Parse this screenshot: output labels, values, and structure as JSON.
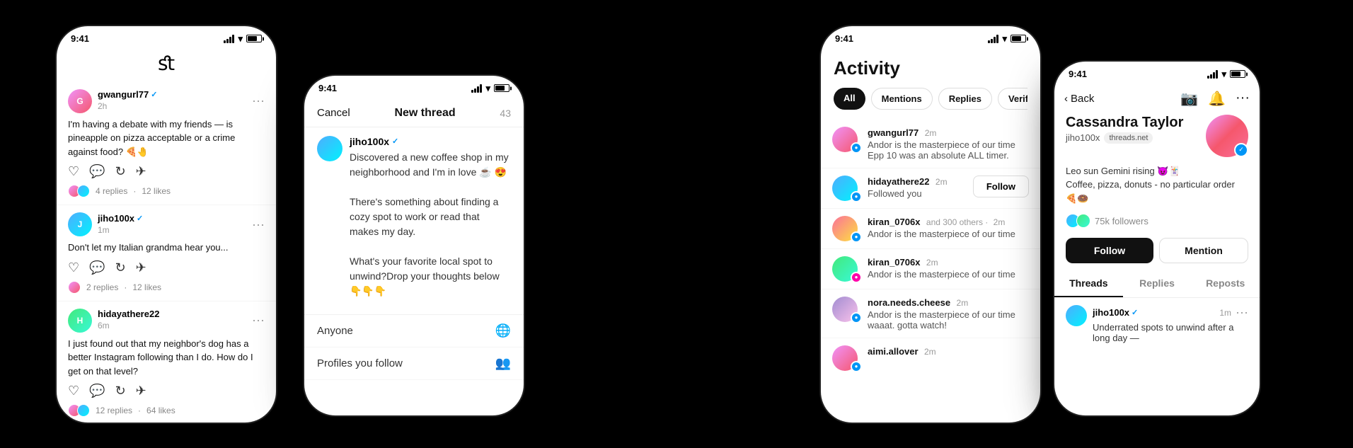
{
  "phone1": {
    "status": {
      "time": "9:41",
      "signal": true,
      "wifi": true,
      "battery": true
    },
    "posts": [
      {
        "username": "gwangurl77",
        "verified": true,
        "time": "2h",
        "content": "I'm having a debate with my friends — is pineapple on pizza acceptable or a crime against food? 🍕🤚",
        "replies": "4 replies",
        "likes": "12 likes",
        "avatar_style": "pink"
      },
      {
        "username": "jiho100x",
        "verified": true,
        "time": "1m",
        "content": "Don't let my Italian grandma hear you...",
        "replies": "2 replies",
        "likes": "12 likes",
        "avatar_style": "blue"
      },
      {
        "username": "hidayathere22",
        "verified": false,
        "time": "6m",
        "content": "I just found out that my neighbor's dog has a better Instagram following than I do. How do I get on that level?",
        "replies": "12 replies",
        "likes": "64 likes",
        "avatar_style": "green"
      }
    ]
  },
  "phone2": {
    "status": {
      "time": "9:41"
    },
    "header": {
      "cancel": "Cancel",
      "title": "New thread",
      "char_count": "43"
    },
    "compose": {
      "username": "jiho100x",
      "verified": true,
      "text": "Discovered a new coffee shop in my neighborhood and I'm in love ☕ 😍\n\nThere's something about finding a cozy spot to work or read that makes my day.\n\nWhat's your favorite local spot to unwind?Drop your thoughts below 👇👇👇"
    },
    "audience": {
      "options": [
        {
          "label": "Anyone",
          "icon": "🌐"
        },
        {
          "label": "Profiles you follow",
          "icon": "👥"
        }
      ]
    }
  },
  "phone3": {
    "status": {
      "time": "9:41"
    },
    "header": {
      "title": "Activity"
    },
    "filters": [
      "All",
      "Mentions",
      "Replies",
      "Verif..."
    ],
    "active_filter": "All",
    "items": [
      {
        "username": "gwangurl77",
        "time": "2m",
        "desc1": "Andor is the masterpiece of our time",
        "desc2": "Epp 10 was an absolute ALL timer.",
        "has_follow": false,
        "avatar_style": "pink"
      },
      {
        "username": "hidayathere22",
        "time": "2m",
        "desc1": "Followed you",
        "desc2": "",
        "has_follow": true,
        "follow_label": "Follow",
        "avatar_style": "blue"
      },
      {
        "username": "kiran_0706x",
        "extra": "and 300 others",
        "time": "2m",
        "desc1": "Andor is the masterpiece of our time",
        "desc2": "",
        "has_follow": false,
        "avatar_style": "orange"
      },
      {
        "username": "kiran_0706x",
        "time": "2m",
        "desc1": "Andor is the masterpiece of our time",
        "desc2": "",
        "has_follow": false,
        "avatar_style": "purple"
      },
      {
        "username": "nora.needs.cheese",
        "time": "2m",
        "desc1": "Andor is the masterpiece of our time",
        "desc2": "waaat. gotta watch!",
        "has_follow": false,
        "avatar_style": "green"
      },
      {
        "username": "aimi.allover",
        "time": "2m",
        "desc1": "",
        "desc2": "",
        "has_follow": false,
        "avatar_style": "pink"
      }
    ]
  },
  "phone4": {
    "status": {
      "time": "9:41"
    },
    "nav": {
      "back": "Back"
    },
    "profile": {
      "name": "Cassandra Taylor",
      "username": "jiho100x",
      "domain": "threads.net",
      "bio_line1": "Leo sun Gemini rising 😈🃏",
      "bio_line2": "Coffee, pizza, donuts - no particular order 🍕🍩",
      "followers": "75k followers"
    },
    "actions": {
      "follow": "Follow",
      "mention": "Mention"
    },
    "tabs": [
      "Threads",
      "Replies",
      "Reposts"
    ],
    "active_tab": "Threads",
    "post": {
      "username": "jiho100x",
      "verified": true,
      "time": "1m",
      "text": "Underrated spots to unwind after a long day —"
    }
  }
}
